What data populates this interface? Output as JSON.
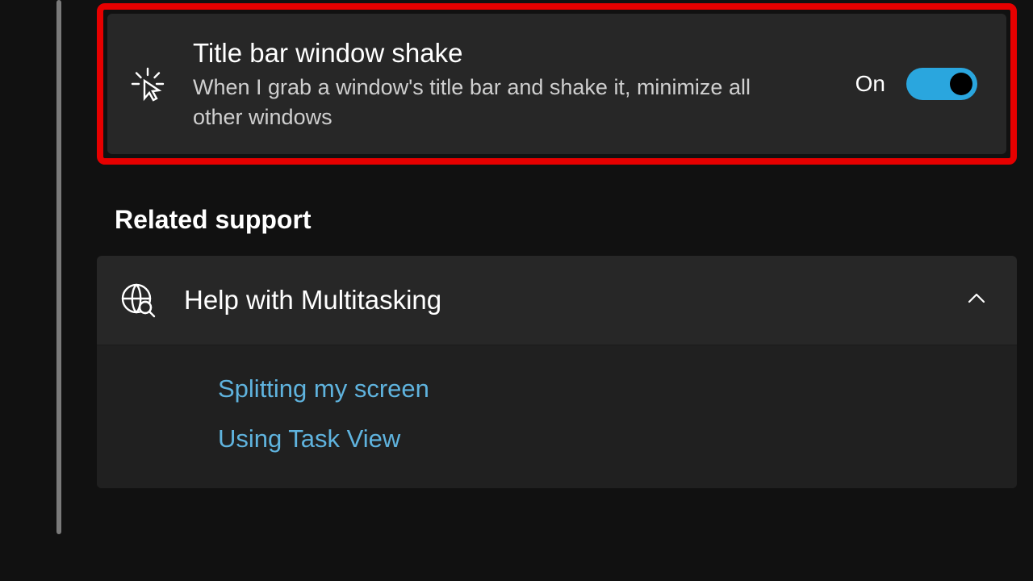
{
  "setting": {
    "title": "Title bar window shake",
    "description": "When I grab a window's title bar and shake it, minimize all other windows",
    "state_label": "On",
    "state_on": true
  },
  "related_support": {
    "heading": "Related support",
    "group_title": "Help with Multitasking",
    "expanded": true,
    "links": [
      "Splitting my screen",
      "Using Task View"
    ]
  },
  "colors": {
    "accent": "#2aa6de",
    "highlight": "#e60000",
    "link": "#5fb3de"
  }
}
